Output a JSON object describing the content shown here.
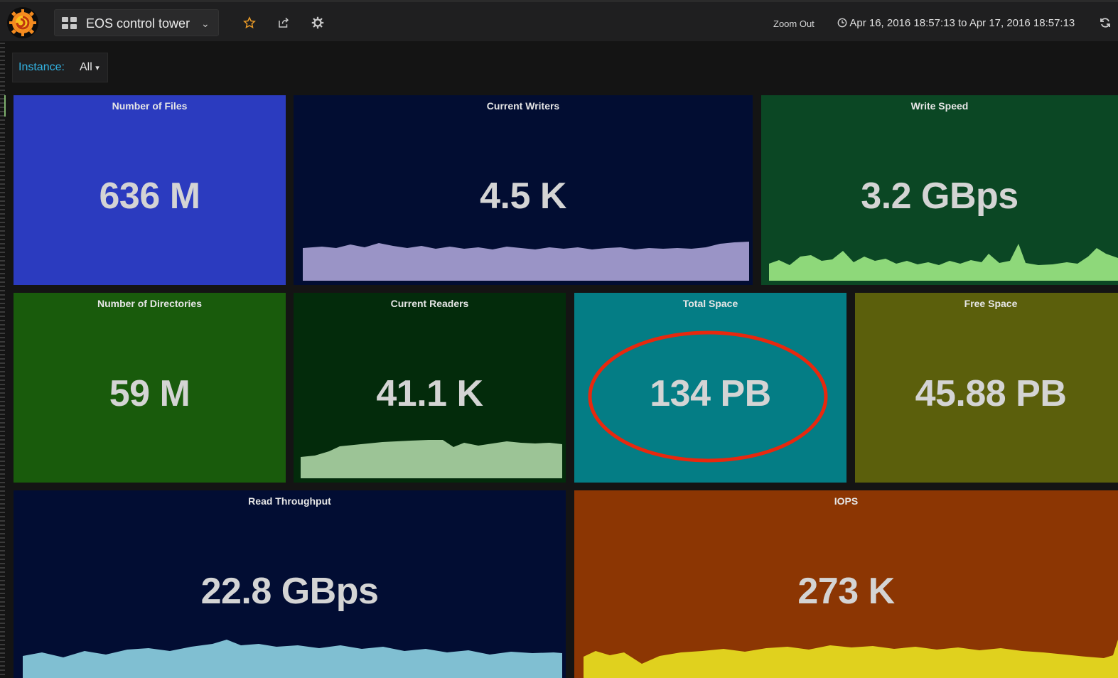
{
  "header": {
    "dashboard_title": "EOS control tower",
    "zoom_out_label": "Zoom Out",
    "time_range": "Apr 16, 2016 18:57:13 to Apr 17, 2016 18:57:13",
    "icons": [
      "grafana-logo-icon",
      "dashboard-grid-icon",
      "caret-down-icon",
      "star-icon",
      "share-icon",
      "gear-icon",
      "clock-icon",
      "refresh-icon"
    ]
  },
  "variables": {
    "instance_label": "Instance:",
    "instance_value": "All"
  },
  "panels": {
    "files": {
      "title": "Number of Files",
      "value": "636 M",
      "color": "#2b3bbf"
    },
    "writers": {
      "title": "Current Writers",
      "value": "4.5 K",
      "color": "#020d32",
      "spark_color": "#9a94c6"
    },
    "write_speed": {
      "title": "Write Speed",
      "value": "3.2 GBps",
      "color": "#0b4724",
      "spark_color": "#8ed87a"
    },
    "directories": {
      "title": "Number of Directories",
      "value": "59 M",
      "color": "#195b0c"
    },
    "readers": {
      "title": "Current Readers",
      "value": "41.1 K",
      "color": "#032b0b",
      "spark_color": "#9cc496"
    },
    "total_space": {
      "title": "Total Space",
      "value": "134 PB",
      "color": "#047d85",
      "annotation_color": "#e8280e"
    },
    "free_space": {
      "title": "Free Space",
      "value": "45.88 PB",
      "color": "#5b5f0c"
    },
    "read_throughput": {
      "title": "Read Throughput",
      "value": "22.8 GBps",
      "color": "#020d33",
      "spark_color": "#80bfd2"
    },
    "iops": {
      "title": "IOPS",
      "value": "273 K",
      "color": "#8c3603",
      "spark_color": "#e0d11e"
    }
  }
}
